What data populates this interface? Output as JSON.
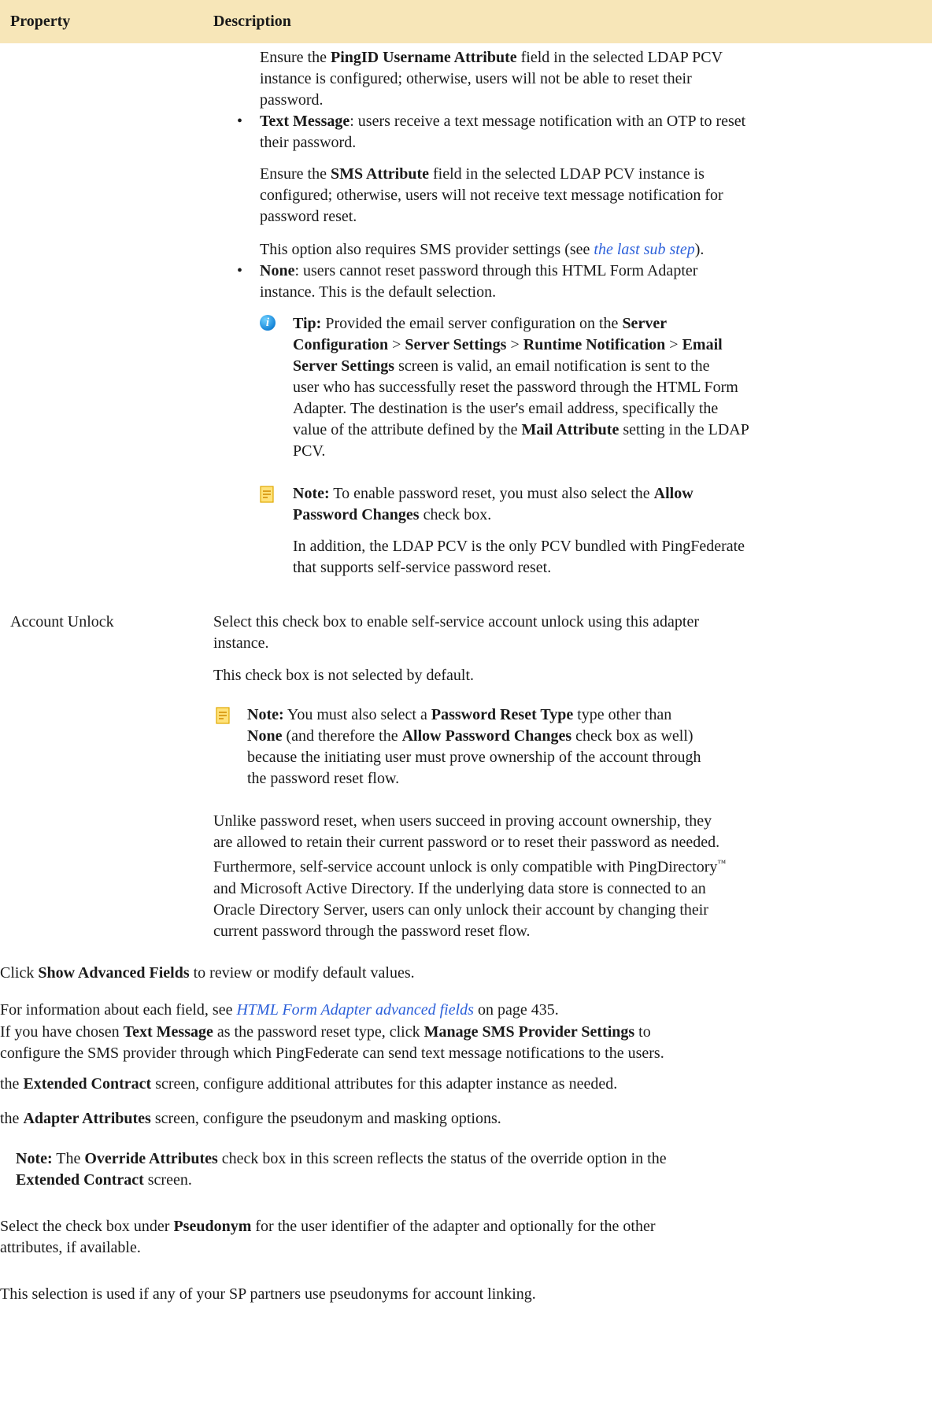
{
  "table": {
    "header": {
      "property": "Property",
      "description": "Description"
    }
  },
  "prev_row": {
    "pingid_para": {
      "l1_a": "Ensure the ",
      "l1_b": "PingID Username Attribute",
      "l1_c": " field in the selected LDAP PCV",
      "l2": "instance is configured; otherwise, users will not be able to reset their",
      "l3": "password."
    },
    "text_message_item": {
      "l1_b": "Text Message",
      "l1_c": ": users receive a text message notification with an OTP to reset",
      "l2": "their password."
    },
    "sms_para": {
      "l1_a": "Ensure the ",
      "l1_b": "SMS Attribute",
      "l1_c": " field in the selected LDAP PCV instance is",
      "l2": "configured; otherwise, users will not receive text message notification for",
      "l3": "password reset."
    },
    "sms_provider_para": {
      "a": "This option also requires SMS provider settings (see ",
      "link": "the last sub step",
      "c": ")."
    },
    "none_item": {
      "l1_b": "None",
      "l1_c": ": users cannot reset password through this HTML Form Adapter",
      "l2": "instance. This is the default selection."
    },
    "tip": {
      "label": "Tip:",
      "l1_c": " Provided the email server configuration on the ",
      "l1_d": "Server",
      "l2_a": "Configuration",
      "l2_b": " > ",
      "l2_c": "Server Settings",
      "l2_d": " > ",
      "l2_e": "Runtime Notification",
      "l2_f": " > ",
      "l2_g": "Email",
      "l3_a": "Server Settings",
      "l3_b": " screen is valid, an email notification is sent to the",
      "l4": "user who has successfully reset the password through the HTML Form",
      "l5": "Adapter. The destination is the user's email address, specifically the",
      "l6_a": "value of the attribute defined by the ",
      "l6_b": "Mail Attribute",
      "l6_c": " setting in the LDAP",
      "l7": "PCV."
    },
    "note1": {
      "label": "Note:",
      "l1_c": " To enable password reset, you must also select the ",
      "l1_d": "Allow",
      "l2_a": "Password Changes",
      "l2_b": " check box.",
      "p2_l1": "In addition, the LDAP PCV is the only PCV bundled with PingFederate",
      "p2_l2": "that supports self-service password reset."
    }
  },
  "account_unlock_row": {
    "property": "Account Unlock",
    "p1_l1": "Select this check box to enable self-service account unlock using this adapter",
    "p1_l2": "instance.",
    "p2": "This check box is not selected by default.",
    "note": {
      "label": "Note:",
      "l1_c": " You must also select a ",
      "l1_d": "Password Reset Type",
      "l1_e": " type other than",
      "l2_a": "None",
      "l2_b": " (and therefore the ",
      "l2_c": "Allow Password Changes",
      "l2_d": " check box as well)",
      "l3": "because the initiating user must prove ownership of the account through",
      "l4": "the password reset flow."
    },
    "p3_l1": "Unlike password reset, when users succeed in proving account ownership, they",
    "p3_l2": "are allowed to retain their current password or to reset their password as needed.",
    "p3_l3_a": "Furthermore, self-service account unlock is only compatible with PingDirectory",
    "p3_l3_tm": "™",
    "p3_l4": "and Microsoft Active Directory. If the underlying data store is connected to an",
    "p3_l5": "Oracle Directory Server, users can only unlock their account by changing their",
    "p3_l6": "current password through the password reset flow."
  },
  "steps": {
    "advanced_a": "Click ",
    "advanced_b": "Show Advanced Fields",
    "advanced_c": " to review or modify default values.",
    "info_a": "For information about each field, see ",
    "info_link": "HTML Form Adapter advanced fields",
    "info_c": " on page 435.",
    "sms_l1_a": "If you have chosen ",
    "sms_l1_b": "Text Message",
    "sms_l1_c": " as the password reset type, click ",
    "sms_l1_d": "Manage SMS Provider Settings",
    "sms_l1_e": " to",
    "sms_l2": "configure the SMS provider through which PingFederate can send text message notifications to the users.",
    "ext_a": "the ",
    "ext_b": "Extended Contract",
    "ext_c": " screen, configure additional attributes for this adapter instance as needed.",
    "attr_a": "the ",
    "attr_b": "Adapter Attributes",
    "attr_c": " screen, configure the pseudonym and masking options.",
    "note_label": "Note:",
    "note_l1_b": " The ",
    "note_l1_c": "Override Attributes",
    "note_l1_d": " check box in this screen reflects the status of the override option in the",
    "note_l2_a": "Extended Contract",
    "note_l2_b": " screen.",
    "pseudo_l1_a": "Select the check box under ",
    "pseudo_l1_b": "Pseudonym",
    "pseudo_l1_c": " for the user identifier of the adapter and optionally for the other",
    "pseudo_l2": "attributes, if available.",
    "linking": "This selection is used if any of your SP partners use pseudonyms for account linking."
  }
}
